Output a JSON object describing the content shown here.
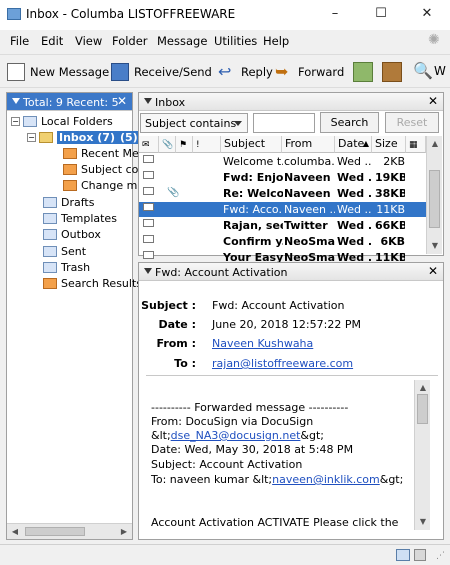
{
  "window": {
    "title": "Inbox - Columba  LISTOFFREEWARE",
    "min": "–",
    "max": "☐",
    "close": "✕"
  },
  "menu": [
    "File",
    "Edit",
    "View",
    "Folder",
    "Message",
    "Utilities",
    "Help"
  ],
  "toolbar": {
    "new_message": "New Message",
    "receive_send": "Receive/Send",
    "reply": "Reply",
    "forward": "Forward"
  },
  "folders": {
    "header": "Total: 9 Recent: 5",
    "local_folders": "Local Folders",
    "inbox": "Inbox (7)",
    "inbox_badge": "(5)",
    "sub": [
      "Recent Me",
      "Subject co",
      "Change m"
    ],
    "others": [
      "Drafts",
      "Templates",
      "Outbox",
      "Sent",
      "Trash",
      "Search Results"
    ]
  },
  "list": {
    "title": "Inbox",
    "filter": "Subject contains",
    "search_button": "Search",
    "reset_button": "Reset",
    "columns": [
      "Subject",
      "From",
      "Date",
      "Size"
    ],
    "messages": [
      {
        "subject": "Welcome t...",
        "from": "columba...",
        "date": "Wed ...",
        "size": "2KB",
        "bold": false,
        "attach": false,
        "selected": false
      },
      {
        "subject": "Fwd: Enjo...",
        "from": "Naveen ...",
        "date": "Wed ...",
        "size": "19KB",
        "bold": true,
        "attach": false,
        "selected": false
      },
      {
        "subject": "Re: Welco...",
        "from": "Naveen ...",
        "date": "Wed ...",
        "size": "38KB",
        "bold": true,
        "attach": true,
        "selected": false
      },
      {
        "subject": "Fwd: Acco...",
        "from": "Naveen ...",
        "date": "Wed ...",
        "size": "11KB",
        "bold": false,
        "attach": false,
        "selected": true
      },
      {
        "subject": "Rajan, see...",
        "from": "Twitter",
        "date": "Wed ...",
        "size": "66KB",
        "bold": true,
        "attach": false,
        "selected": false
      },
      {
        "subject": "Confirm y...",
        "from": "NeoSma...",
        "date": "Wed ...",
        "size": "6KB",
        "bold": true,
        "attach": false,
        "selected": false
      },
      {
        "subject": "Your Easy...",
        "from": "NeoSma...",
        "date": "Wed ...",
        "size": "11KB",
        "bold": true,
        "attach": false,
        "selected": false
      }
    ]
  },
  "reader": {
    "title": "Fwd: Account Activation",
    "labels": {
      "subject": "Subject :",
      "date": "Date :",
      "from": "From :",
      "to": "To :"
    },
    "subject": "Fwd: Account Activation",
    "date": "June 20, 2018 12:57:22 PM",
    "from": "Naveen Kushwaha",
    "to": "rajan@listoffreeware.com",
    "body": {
      "line1": "---------- Forwarded message ----------",
      "line2": "From: DocuSign via DocuSign",
      "line3_prefix": "&lt;",
      "line3_link": "dse_NA3@docusign.net",
      "line3_suffix": "&gt;",
      "line4": "Date: Wed, May 30, 2018 at 5:48 PM",
      "line5": "Subject: Account Activation",
      "line6_prefix": "To: naveen kumar &lt;",
      "line6_link": "naveen@inklik.com",
      "line6_suffix": "&gt;",
      "line7": "Account Activation  ACTIVATE Please click the"
    }
  }
}
